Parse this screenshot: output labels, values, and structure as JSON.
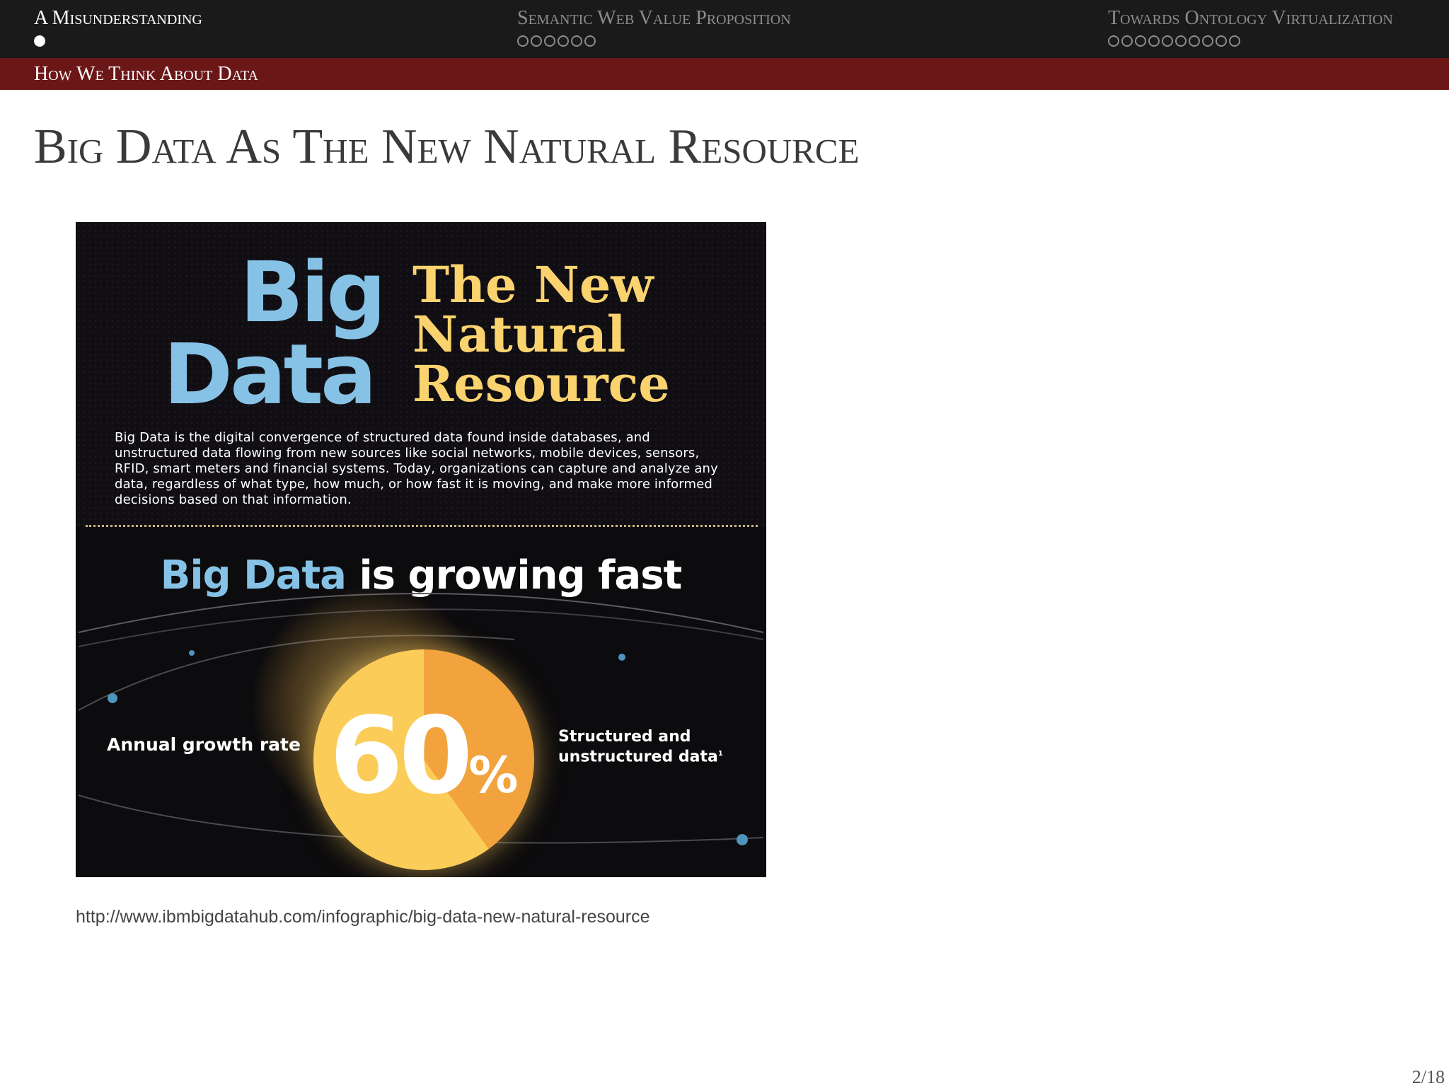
{
  "nav": {
    "sections": [
      {
        "title": "A Misunderstanding",
        "dots": 1,
        "current": 0
      },
      {
        "title": "Semantic Web Value Proposition",
        "dots": 6,
        "current": -1
      },
      {
        "title": "Towards Ontology Virtualization",
        "dots": 10,
        "current": -1
      }
    ],
    "subsection": "How We Think About Data"
  },
  "slide": {
    "title": "Big Data As The New Natural Resource"
  },
  "infographic": {
    "big_line1": "Big",
    "big_line2": "Data",
    "resource_line1": "The New",
    "resource_line2": "Natural",
    "resource_line3": "Resource",
    "description": "Big Data is the digital convergence of structured data found inside databases, and unstructured data flowing from new sources like social networks, mobile devices, sensors, RFID, smart meters and financial systems. Today, organizations can capture and analyze any data, regardless of what type, how much, or how fast it is moving, and make more informed decisions based on that information.",
    "growing_highlight": "Big Data",
    "growing_rest": "is growing fast",
    "left_label": "Annual growth rate",
    "percent_number": "60",
    "percent_sign": "%",
    "right_label_line1": "Structured and",
    "right_label_line2": "unstructured data",
    "footnote_mark": "1",
    "pie_share": 0.4,
    "colors": {
      "blue": "#85c2e6",
      "yellow": "#fad36f",
      "pie_light": "#fbcc58",
      "pie_dark": "#f2a33e",
      "background": "#0c0b0d"
    }
  },
  "caption": {
    "source_url": "http://www.ibmbigdatahub.com/infographic/big-data-new-natural-resource"
  },
  "footer": {
    "page_number": "2/18"
  },
  "theme": {
    "nav_background": "#1a1a1a",
    "subbar_background": "#6b1718"
  }
}
